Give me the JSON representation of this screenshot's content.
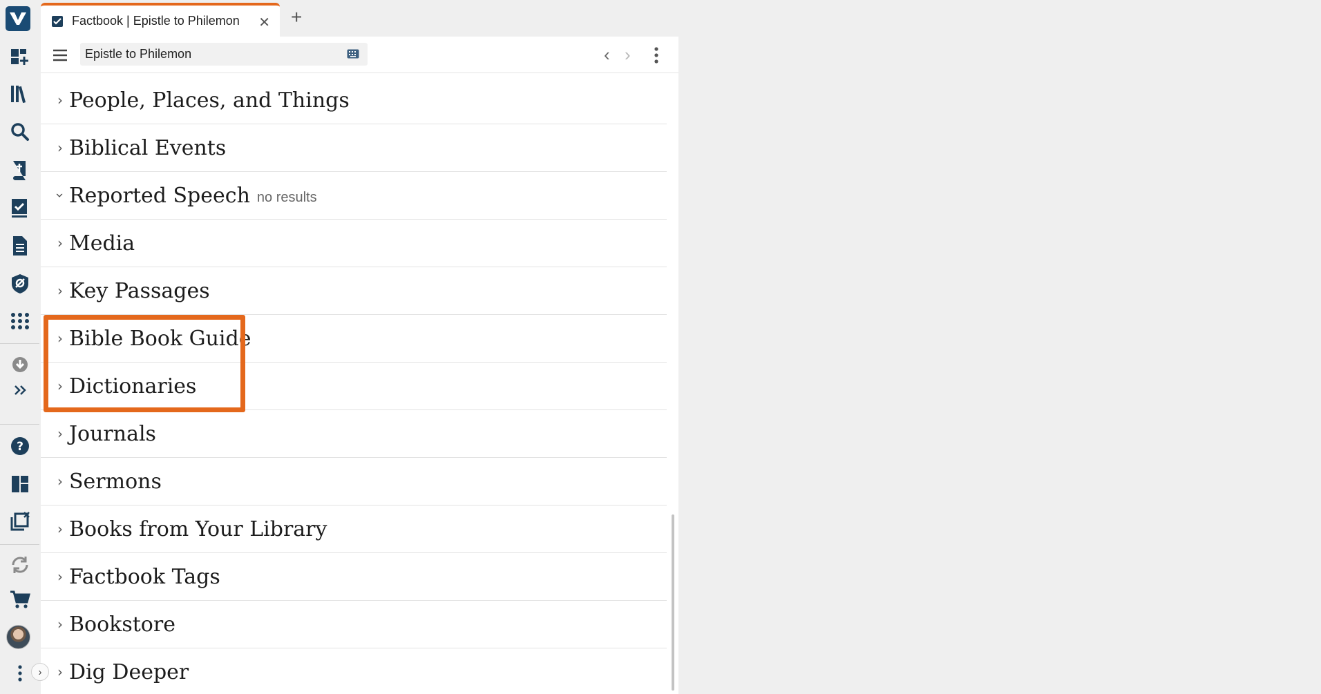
{
  "tab": {
    "title": "Factbook | Epistle to Philemon",
    "close": "✕"
  },
  "new_tab": "+",
  "toolbar": {
    "reference": "Epistle to Philemon",
    "back": "‹",
    "forward": "›"
  },
  "sections": [
    {
      "title": "People, Places, and Things",
      "note": "",
      "expanded": false
    },
    {
      "title": "Biblical Events",
      "note": "",
      "expanded": false
    },
    {
      "title": "Reported Speech",
      "note": "no results",
      "expanded": true
    },
    {
      "title": "Media",
      "note": "",
      "expanded": false
    },
    {
      "title": "Key Passages",
      "note": "",
      "expanded": false
    },
    {
      "title": "Bible Book Guide",
      "note": "",
      "expanded": false
    },
    {
      "title": "Dictionaries",
      "note": "",
      "expanded": false
    },
    {
      "title": "Journals",
      "note": "",
      "expanded": false
    },
    {
      "title": "Sermons",
      "note": "",
      "expanded": false
    },
    {
      "title": "Books from Your Library",
      "note": "",
      "expanded": false
    },
    {
      "title": "Factbook Tags",
      "note": "",
      "expanded": false
    },
    {
      "title": "Bookstore",
      "note": "",
      "expanded": false
    },
    {
      "title": "Dig Deeper",
      "note": "",
      "expanded": false
    }
  ],
  "sidebar": {
    "icons": [
      "dashboard-add-icon",
      "library-icon",
      "search-icon",
      "bible-icon",
      "factbook-icon",
      "document-icon",
      "guides-icon",
      "apps-grid-icon",
      "download-icon",
      "expand-more-icon",
      "help-icon",
      "layouts-icon",
      "close-panels-icon",
      "sync-icon",
      "cart-icon",
      "avatar",
      "more-vertical-icon"
    ]
  },
  "colors": {
    "accent": "#e4681c",
    "logo": "#1a4b74",
    "icon": "#1d3f5b"
  }
}
